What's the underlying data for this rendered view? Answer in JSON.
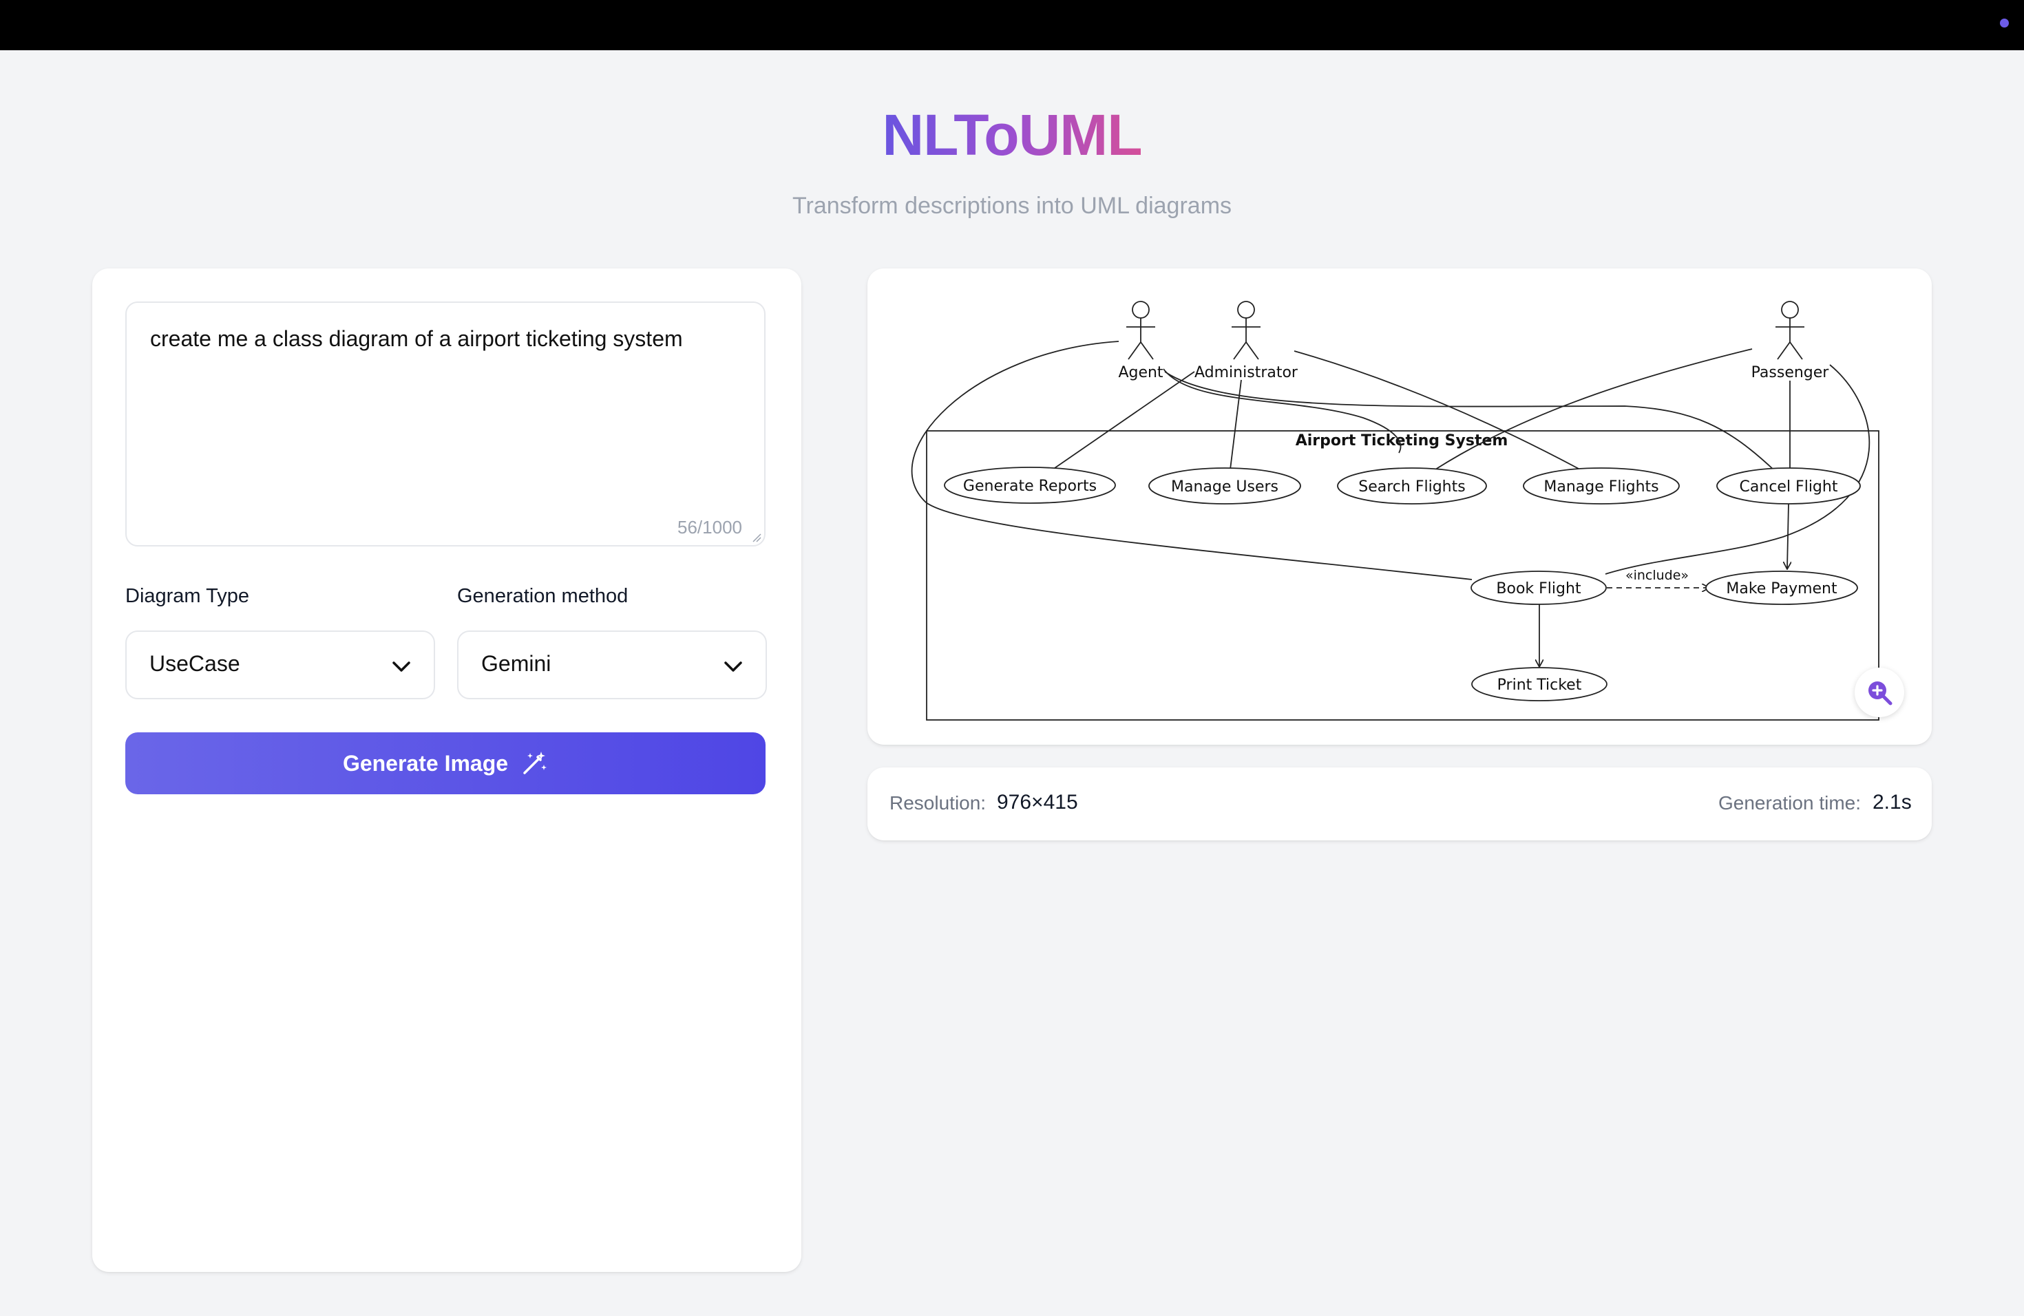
{
  "app": {
    "title": "NLToUML",
    "subtitle": "Transform descriptions into UML diagrams"
  },
  "prompt": {
    "value": "create me a class diagram of a airport ticketing system",
    "char_count": "56/1000"
  },
  "diagram_type": {
    "label": "Diagram Type",
    "selected": "UseCase"
  },
  "generation_method": {
    "label": "Generation method",
    "selected": "Gemini"
  },
  "generate_button": {
    "label": "Generate Image"
  },
  "diagram": {
    "system_name": "Airport Ticketing System",
    "actors": [
      "Agent",
      "Administrator",
      "Passenger"
    ],
    "use_cases": [
      "Generate Reports",
      "Manage Users",
      "Search Flights",
      "Manage Flights",
      "Cancel Flight",
      "Book Flight",
      "Make Payment",
      "Print Ticket"
    ],
    "include_label": "«include»"
  },
  "info": {
    "resolution_label": "Resolution:",
    "resolution_value": "976×415",
    "time_label": "Generation time:",
    "time_value": "2.1s"
  },
  "colors": {
    "accent": "#4f46e5",
    "title_gradient": [
      "#6a55e0",
      "#d44f9a"
    ],
    "background": "#f3f4f6"
  }
}
